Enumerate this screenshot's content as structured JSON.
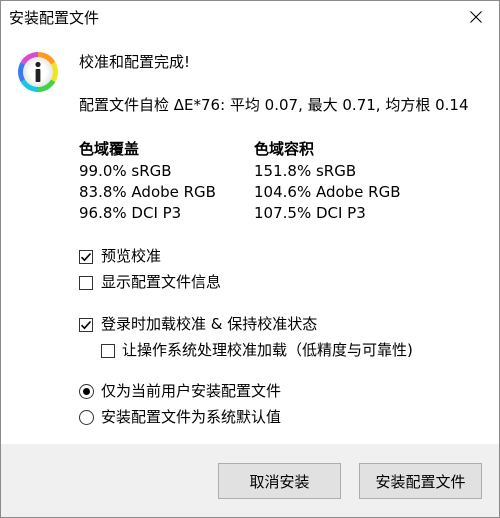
{
  "window": {
    "title": "安装配置文件"
  },
  "header": {
    "icon": "info-icon",
    "heading": "校准和配置完成!",
    "summary": "配置文件自检 ΔE*76: 平均 0.07, 最大 0.71, 均方根 0.14"
  },
  "coverage": {
    "title": "色域覆盖",
    "rows": [
      "99.0% sRGB",
      "83.8% Adobe RGB",
      "96.8% DCI P3"
    ]
  },
  "volume": {
    "title": "色域容积",
    "rows": [
      "151.8% sRGB",
      "104.6% Adobe RGB",
      "107.5% DCI P3"
    ]
  },
  "options": {
    "preview": {
      "label": "预览校准",
      "checked": true
    },
    "show_info": {
      "label": "显示配置文件信息",
      "checked": false
    },
    "load_on_login": {
      "label": "登录时加载校准 & 保持校准状态",
      "checked": true
    },
    "os_load": {
      "label": "让操作系统处理校准加载（低精度与可靠性)",
      "checked": false
    }
  },
  "install_target": {
    "current_user": {
      "label": "仅为当前用户安装配置文件",
      "selected": true
    },
    "system_default": {
      "label": "安装配置文件为系统默认值",
      "selected": false
    }
  },
  "buttons": {
    "cancel": "取消安装",
    "install": "安装配置文件"
  }
}
